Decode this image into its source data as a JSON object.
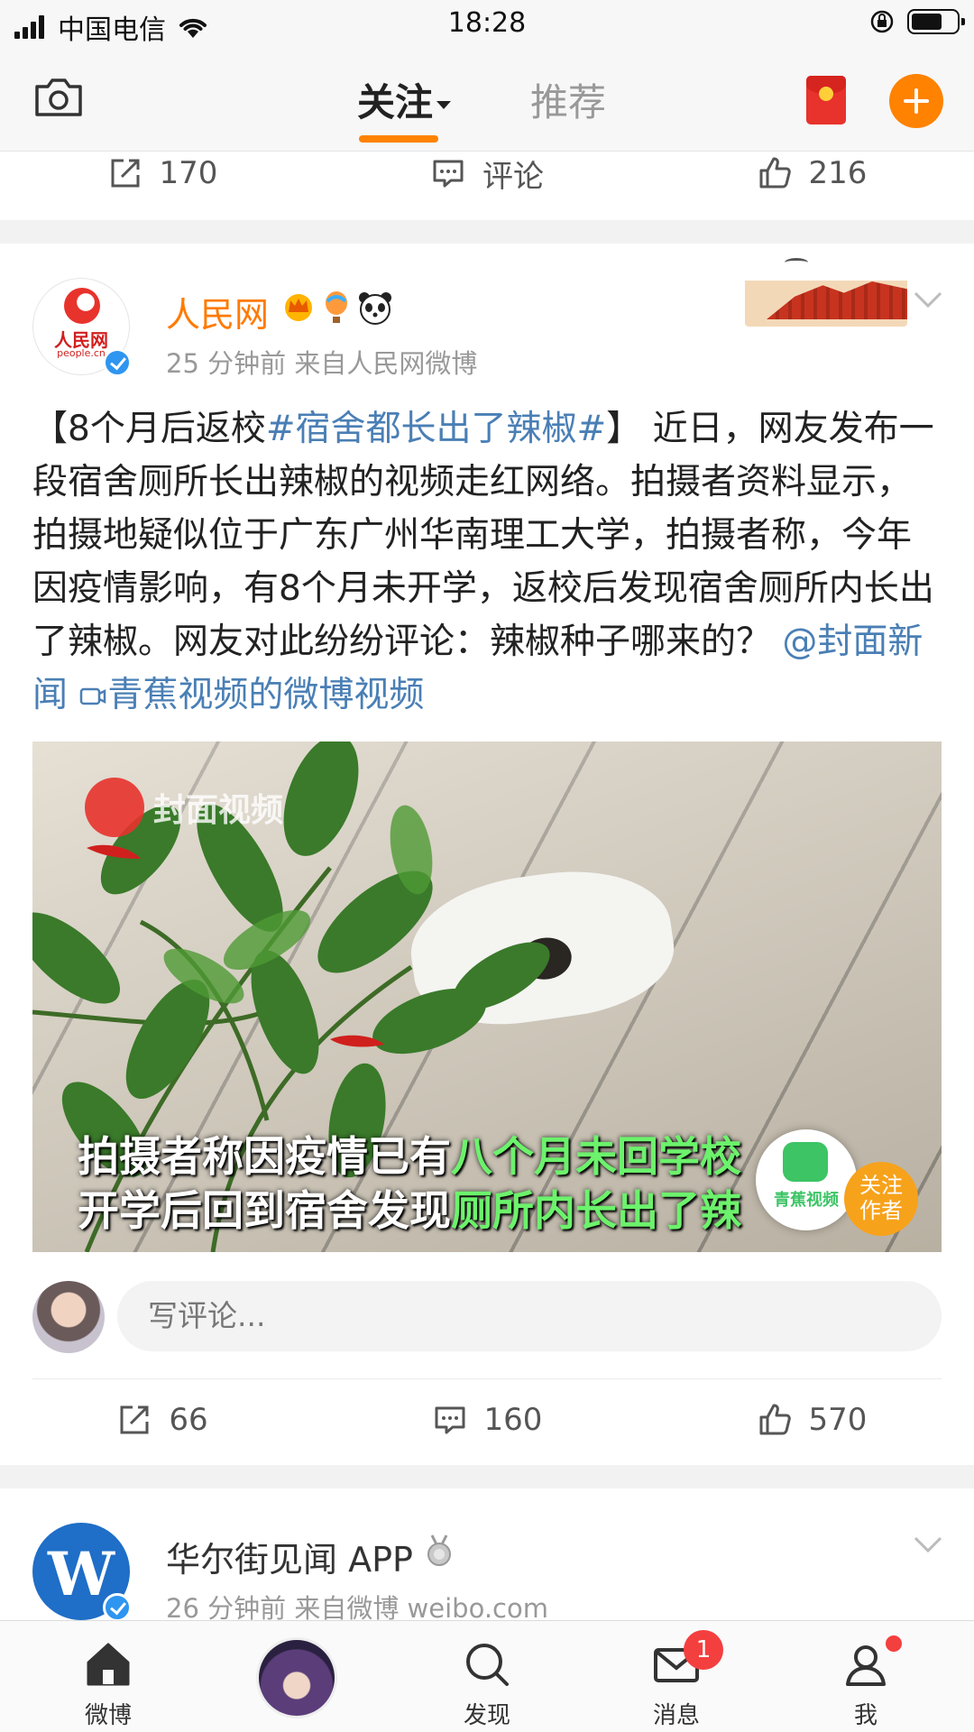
{
  "status_bar": {
    "carrier": "中国电信",
    "time": "18:28"
  },
  "header": {
    "tabs": [
      {
        "label": "关注",
        "active": true
      },
      {
        "label": "推荐",
        "active": false
      }
    ],
    "accent_color": "#ff8200"
  },
  "prev_post_actions": {
    "repost_count": "170",
    "comment_label": "评论",
    "like_count": "216"
  },
  "post": {
    "author": "人民网",
    "avatar_text": "人民网",
    "avatar_sub": "people.cn",
    "badges": [
      "crown-icon",
      "balloon-icon",
      "panda-icon"
    ],
    "meta": "25 分钟前  来自人民网微博",
    "text_parts": {
      "open": "【8个月后返校",
      "hashtag": "#宿舍都长出了辣椒#",
      "body": "】 近日，网友发布一段宿舍厕所长出辣椒的视频走红网络。拍摄者资料显示，拍摄地疑似位于广东广州华南理工大学，拍摄者称，今年因疫情影响，有8个月未开学，返校后发现宿舍厕所内长出了辣椒。网友对此纷纷评论：辣椒种子哪来的？",
      "mention": "@封面新闻",
      "video_link": "青蕉视频的微博视频"
    },
    "video": {
      "watermark": "封面视频",
      "subtitle_line1_white": "拍摄者称因疫情已有",
      "subtitle_line1_green": "八个月未回学校",
      "subtitle_line2_white": "开学后回到宿舍发现",
      "subtitle_line2_green": "厕所内长出了辣",
      "channel_badge": "青蕉视频",
      "follow_label_1": "关注",
      "follow_label_2": "作者"
    },
    "comment_placeholder": "写评论...",
    "actions": {
      "repost_count": "66",
      "comment_count": "160",
      "like_count": "570"
    }
  },
  "next_post": {
    "author": "华尔街见闻 APP",
    "avatar_text": "W",
    "meta": "26 分钟前  来自微博 weibo.com"
  },
  "tabbar": {
    "items": [
      {
        "label": "微博"
      },
      {
        "label": ""
      },
      {
        "label": "发现"
      },
      {
        "label": "消息",
        "badge": "1"
      },
      {
        "label": "我"
      }
    ]
  }
}
